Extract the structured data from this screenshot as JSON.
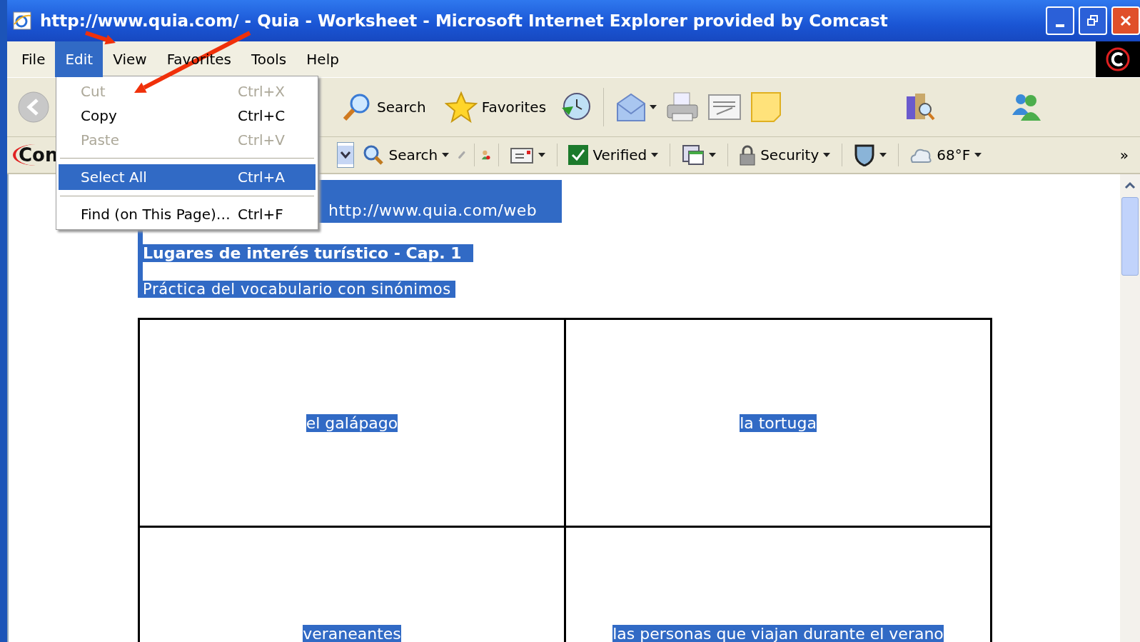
{
  "window": {
    "title": "http://www.quia.com/ - Quia - Worksheet - Microsoft Internet Explorer provided by Comcast"
  },
  "menu_bar": [
    {
      "label": "File",
      "selected": false
    },
    {
      "label": "Edit",
      "selected": true
    },
    {
      "label": "View",
      "selected": false
    },
    {
      "label": "Favorites",
      "selected": false
    },
    {
      "label": "Tools",
      "selected": false
    },
    {
      "label": "Help",
      "selected": false
    }
  ],
  "edit_menu": {
    "groups": [
      [
        {
          "label": "Cut",
          "shortcut": "Ctrl+X",
          "disabled": true,
          "selected": false
        },
        {
          "label": "Copy",
          "shortcut": "Ctrl+C",
          "disabled": false,
          "selected": false
        },
        {
          "label": "Paste",
          "shortcut": "Ctrl+V",
          "disabled": true,
          "selected": false
        }
      ],
      [
        {
          "label": "Select All",
          "shortcut": "Ctrl+A",
          "disabled": false,
          "selected": true
        }
      ],
      [
        {
          "label": "Find (on This Page)…",
          "shortcut": "Ctrl+F",
          "disabled": false,
          "selected": false
        }
      ]
    ]
  },
  "toolbar": {
    "search_label": "Search",
    "favorites_label": "Favorites"
  },
  "links_bar": {
    "logo": "Con",
    "search_label": "Search",
    "verified_label": "Verified",
    "security_label": "Security",
    "weather": "68°F",
    "more": "»"
  },
  "page": {
    "all_selected": true,
    "url": "http://www.quia.com/web",
    "heading": "Lugares de interés turístico - Cap. 1",
    "subtitle": "Práctica del vocabulario con sinónimos",
    "rows": [
      [
        "el galápago",
        "la tortuga"
      ],
      [
        "veraneantes",
        "las personas que viajan durante el verano"
      ]
    ]
  }
}
